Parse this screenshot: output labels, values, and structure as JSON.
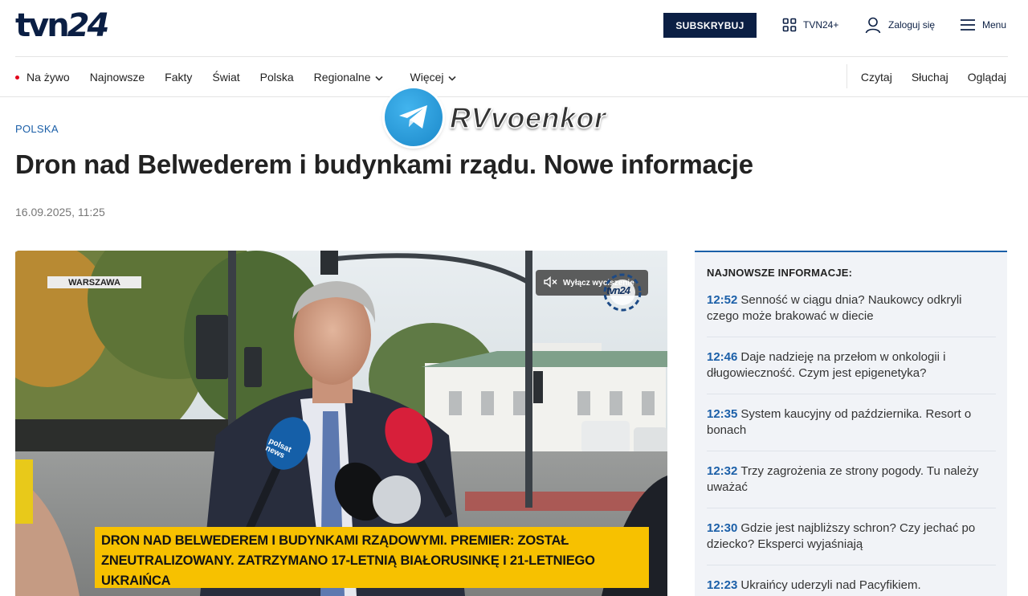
{
  "header": {
    "logo_text": "tvn",
    "logo_num": "24",
    "subscribe_label": "SUBSKRYBUJ",
    "tvn24plus_label": "TVN24+",
    "login_label": "Zaloguj się",
    "menu_label": "Menu"
  },
  "nav": {
    "items": [
      "Na żywo",
      "Najnowsze",
      "Fakty",
      "Świat",
      "Polska",
      "Regionalne",
      "Więcej"
    ],
    "right_items": [
      "Czytaj",
      "Słuchaj",
      "Oglądaj"
    ]
  },
  "watermark": {
    "channel": "RVvoenkor"
  },
  "article": {
    "section": "POLSKA",
    "title": "Dron nad Belwederem i budynkami rządu. Nowe informacje",
    "date": "16.09.2025, 11:25"
  },
  "video": {
    "location_tag": "WARSZAWA",
    "unmute_label": "Wyłącz wyciszenie",
    "bug_text": "tvn24",
    "ticker_line1": "DRON NAD BELWEDEREM I BUDYNKAMI RZĄDOWYMI. PREMIER: ZOSTAŁ",
    "ticker_line2": "ZNEUTRALIZOWANY. ZATRZYMANO 17-LETNIĄ BIAŁORUSINKĘ I 21-LETNIEGO UKRAIŃCA",
    "mic_labels": [
      "polsat news"
    ]
  },
  "sidebar": {
    "title": "NAJNOWSZE INFORMACJE:",
    "items": [
      {
        "time": "12:52",
        "text": "Senność w ciągu dnia? Naukowcy odkryli czego może brakować w diecie"
      },
      {
        "time": "12:46",
        "text": "Daje nadzieję na przełom w onkologii i długowieczność. Czym jest epigenetyka?"
      },
      {
        "time": "12:35",
        "text": "System kaucyjny od października. Resort o bonach"
      },
      {
        "time": "12:32",
        "text": "Trzy zagrożenia ze strony pogody. Tu należy uważać"
      },
      {
        "time": "12:30",
        "text": "Gdzie jest najbliższy schron? Czy jechać po dziecko? Eksperci wyjaśniają"
      },
      {
        "time": "12:23",
        "text": "Ukraińcy uderzyli nad Pacyfikiem."
      }
    ]
  },
  "colors": {
    "brand_navy": "#0b1f44",
    "link_blue": "#1b5fa8",
    "live_red": "#e2001a",
    "ticker_yellow": "#f7c100"
  },
  "icons": [
    "grid-icon",
    "user-icon",
    "hamburger-icon",
    "chevron-down-icon",
    "telegram-icon",
    "mute-icon"
  ]
}
